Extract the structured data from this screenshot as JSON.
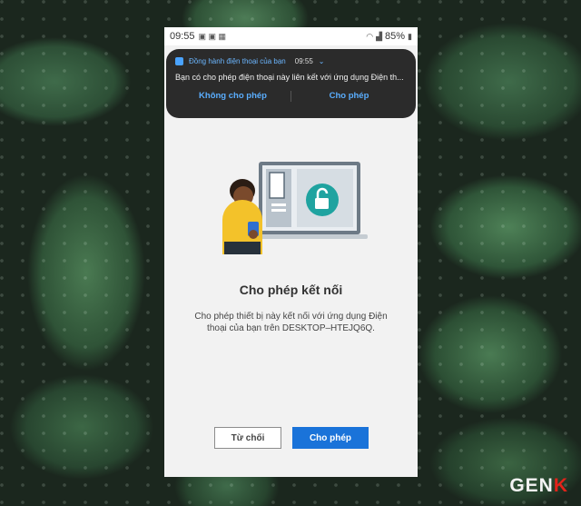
{
  "status_bar": {
    "time": "09:55",
    "battery": "85%"
  },
  "notification": {
    "app_name": "Đồng hành điện thoại của bạn",
    "time": "09:55",
    "message": "Bạn có cho phép điện thoại này liên kết với ứng dụng Điện th...",
    "deny_label": "Không cho phép",
    "allow_label": "Cho phép"
  },
  "dialog": {
    "title": "Cho phép kết nối",
    "description": "Cho phép thiết bị này kết nối với ứng dụng Điện thoại của bạn trên DESKTOP–HTEJQ6Q.",
    "deny_button": "Từ chối",
    "allow_button": "Cho phép"
  },
  "watermark": {
    "text_main": "GEN",
    "text_accent": "K"
  },
  "colors": {
    "accent": "#1a73d9",
    "notification_bg": "#2b2b2b",
    "notification_link": "#5aaeff"
  }
}
